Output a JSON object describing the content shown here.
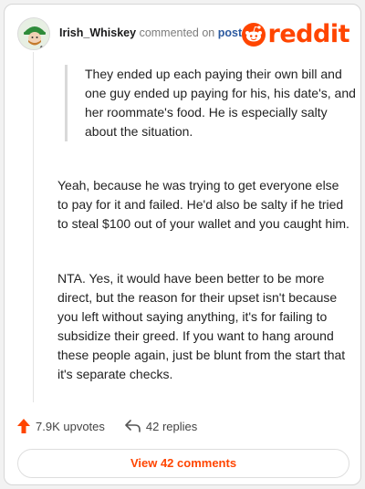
{
  "header": {
    "username": "Irish_Whiskey",
    "action_text": "commented on",
    "post_link": "post",
    "brand": "reddit",
    "brand_color": "#ff4500"
  },
  "comment": {
    "quote": "They ended up each paying their own bill and one guy ended up paying for his, his date's, and her roommate's food. He is especially salty about the situation.",
    "paragraphs": [
      "Yeah, because he was trying to get everyone else to pay for it and failed. He'd also be salty if he tried to steal $100 out of your wallet and you caught him.",
      "NTA. Yes, it would have been better to be more direct, but the reason for their upset isn't because you left without saying anything, it's for failing to subsidize their greed. If you want to hang around these people again, just be blunt from the start that it's separate checks."
    ]
  },
  "footer": {
    "upvotes": "7.9K upvotes",
    "replies": "42 replies",
    "view_comments": "View 42 comments",
    "upvote_icon": "upvote-arrow-icon",
    "reply_icon": "reply-arrow-icon"
  }
}
